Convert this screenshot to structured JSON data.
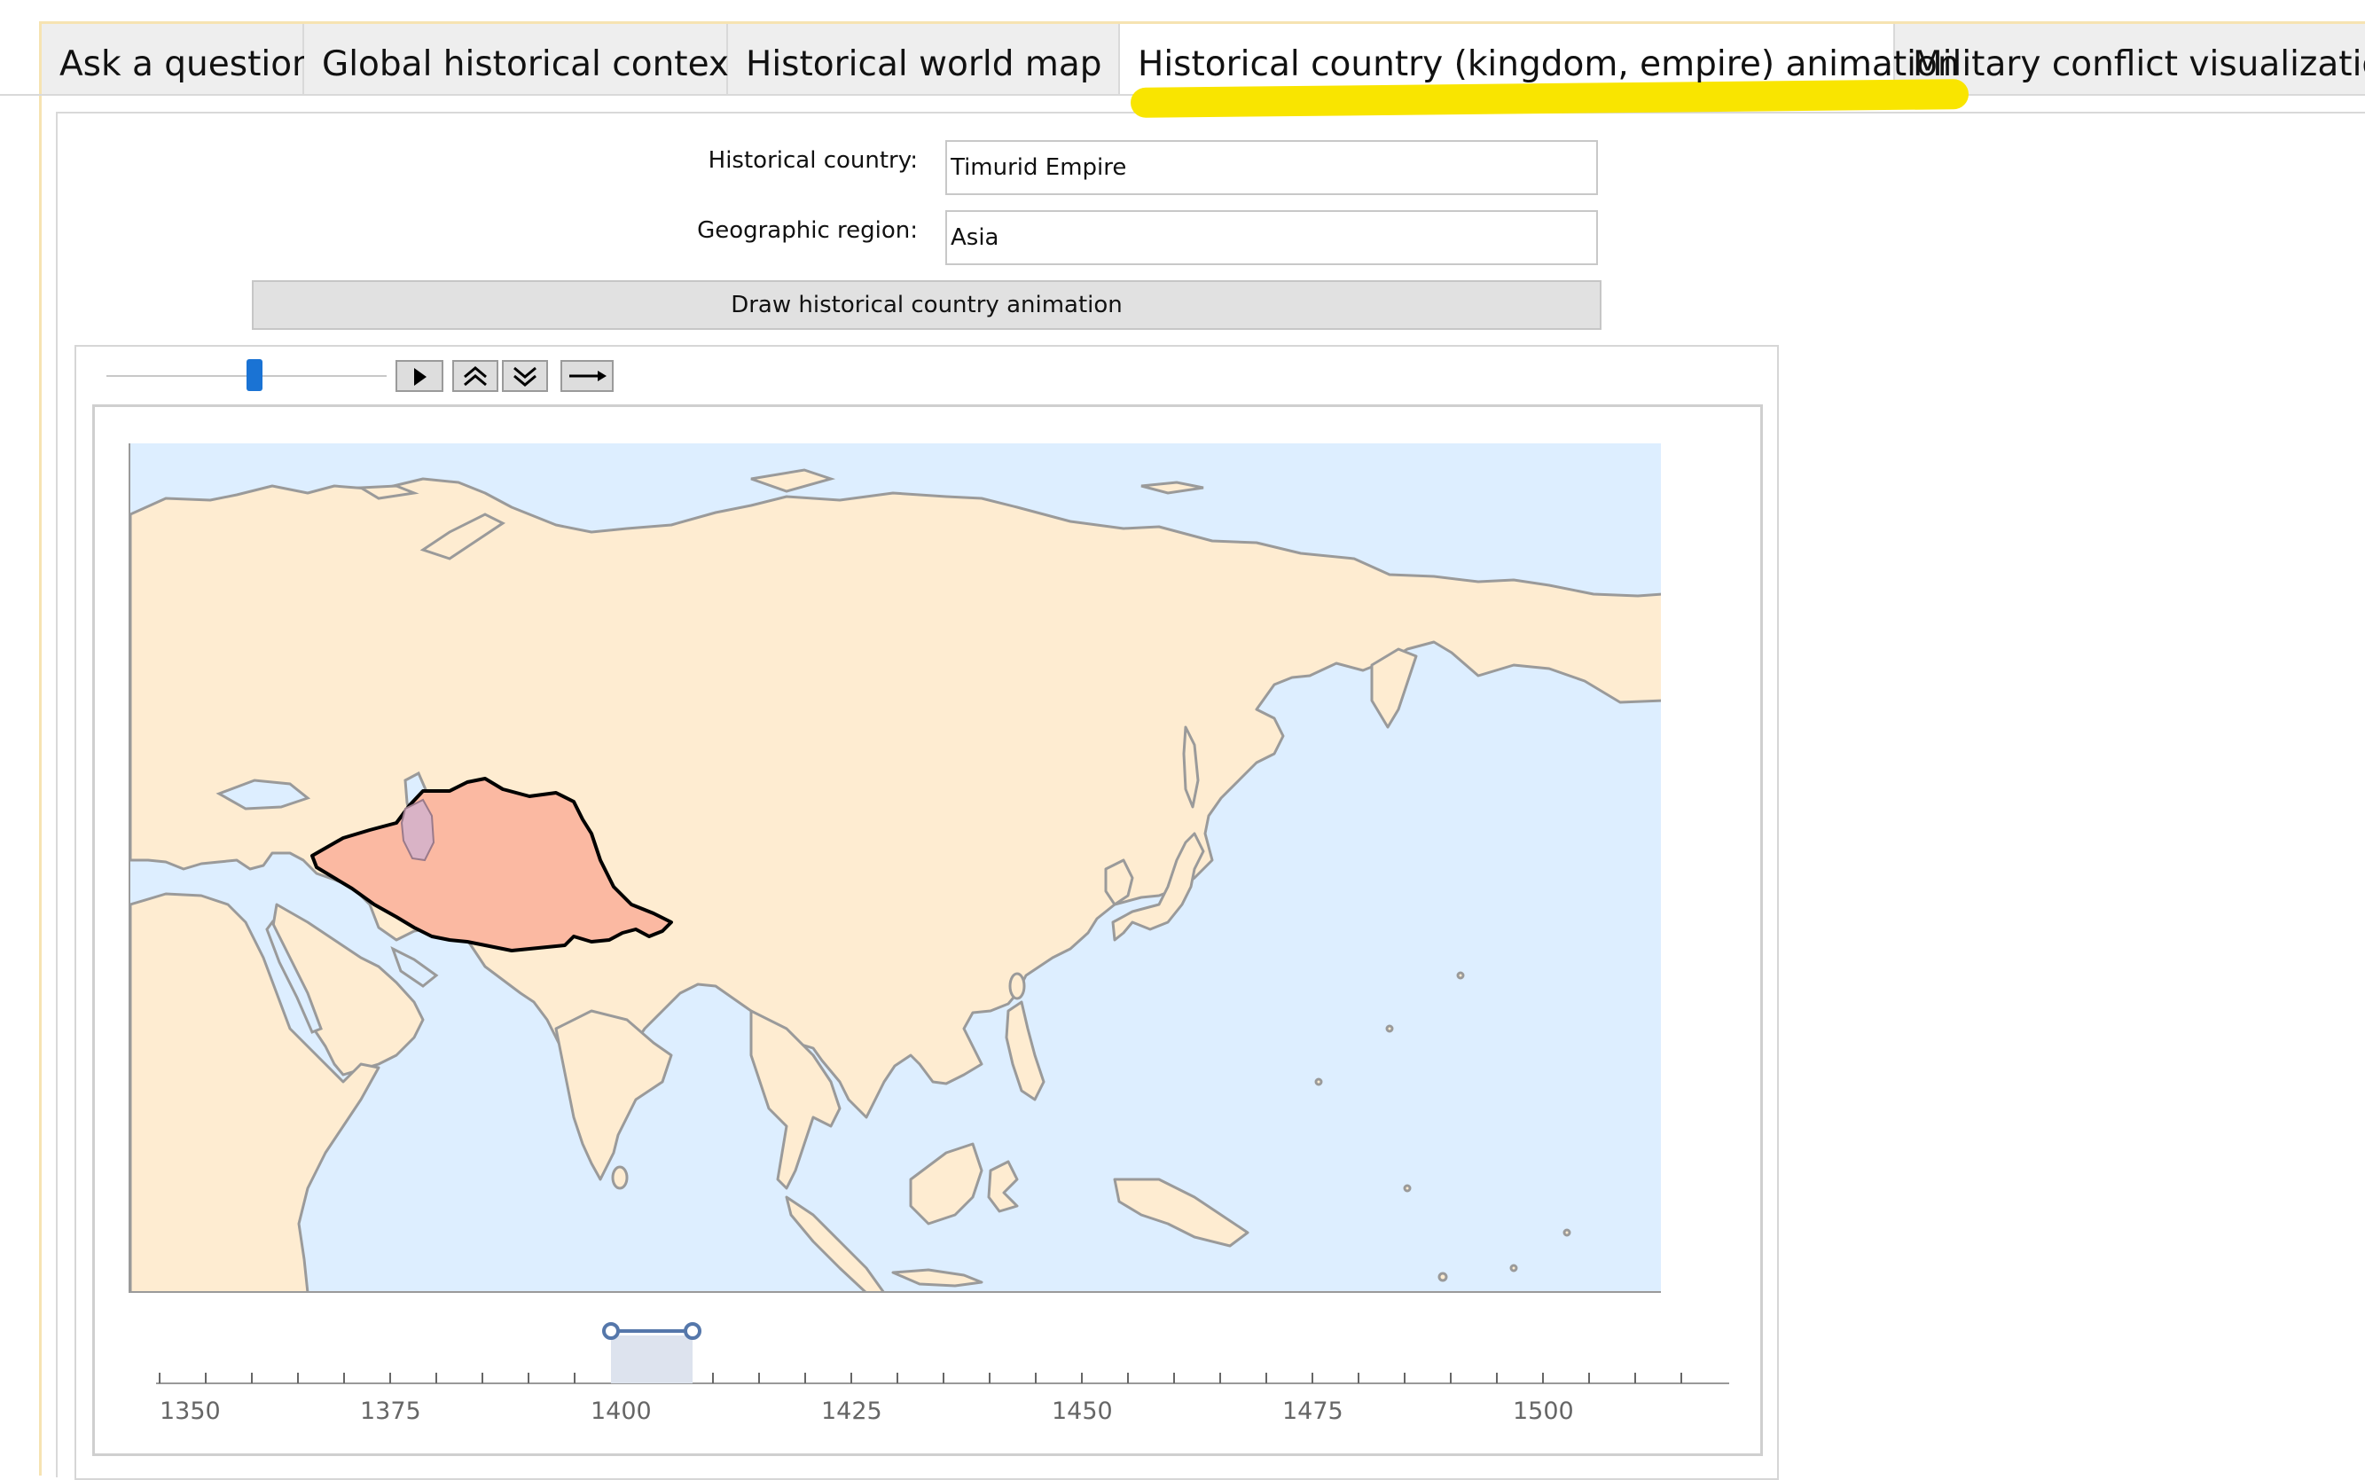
{
  "tabs": [
    {
      "label": "Ask a question",
      "active": false
    },
    {
      "label": "Global historical context",
      "active": false
    },
    {
      "label": "Historical world map",
      "active": false
    },
    {
      "label": "Historical country (kingdom, empire) animation",
      "active": true
    },
    {
      "label": "Military conflict visualization",
      "active": false
    }
  ],
  "form": {
    "country_label": "Historical country:",
    "country_value": "Timurid Empire",
    "region_label": "Geographic region:",
    "region_value": "Asia",
    "draw_button": "Draw historical country animation"
  },
  "controls": {
    "slider_fraction": 0.47,
    "icons": [
      "play-icon",
      "speed-up-icon",
      "slow-down-icon",
      "direction-icon"
    ]
  },
  "map": {
    "region": "Asia",
    "highlighted_country": "Timurid Empire",
    "colors": {
      "ocean": "#ddeeff",
      "land": "#feecd1",
      "coast": "#9a9a9a",
      "empire_fill": "#fbb9a2",
      "empire_border": "#000000",
      "inner_region_fill": "#d9b3c6"
    }
  },
  "timeline": {
    "ticks": [
      "1350",
      "1375",
      "1400",
      "1425",
      "1450",
      "1475",
      "1500"
    ],
    "range_start": 1400,
    "range_end": 1409,
    "range_color": "#5577aa"
  }
}
